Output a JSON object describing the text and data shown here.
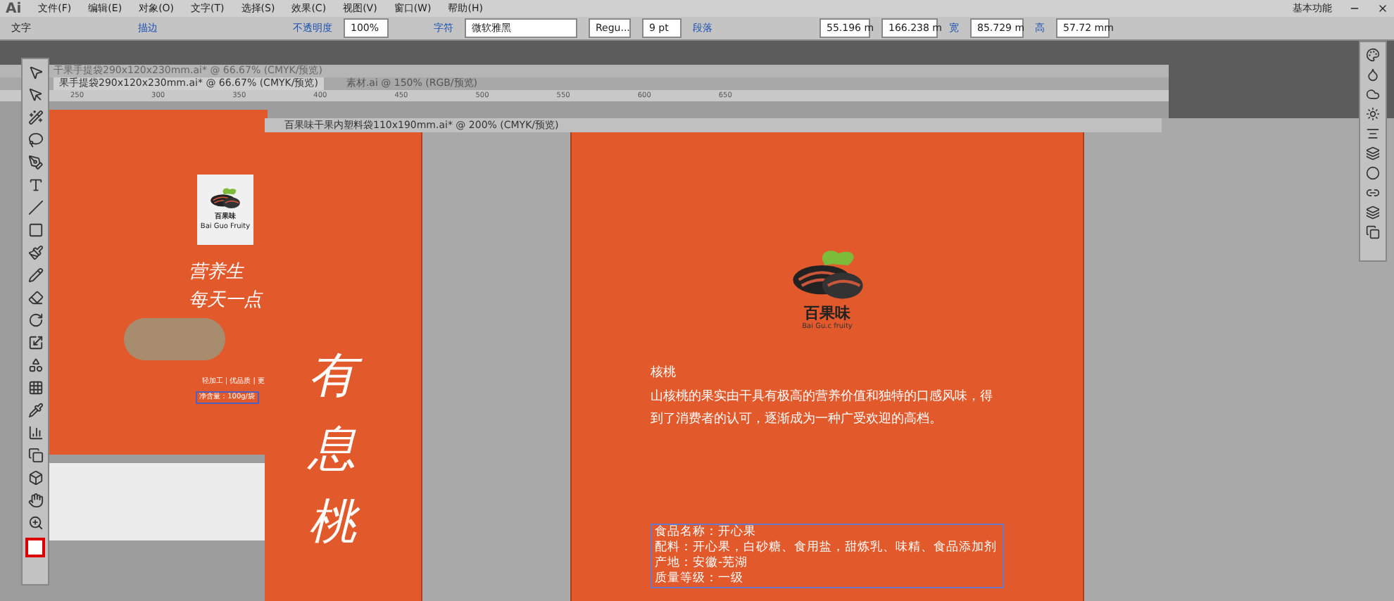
{
  "app": {
    "logo": "Ai",
    "menu": [
      "文件(F)",
      "编辑(E)",
      "对象(O)",
      "文字(T)",
      "选择(S)",
      "效果(C)",
      "视图(V)",
      "窗口(W)",
      "帮助(H)"
    ],
    "workspace": "基本功能"
  },
  "control_bar": {
    "tool": "文字",
    "stroke_label": "描边",
    "opacity_label": "不透明度",
    "opacity": "100%",
    "char_label": "字符",
    "font": "微软雅黑",
    "style": "Regu...",
    "size": "9 pt",
    "para_label": "段落",
    "x": "55.196 m",
    "y": "166.238 m",
    "w_label": "宽",
    "w": "85.729 m",
    "h_label": "高",
    "h": "57.72 mm"
  },
  "back_window": {
    "title": "干果手提袋290x120x230mm.ai* @ 66.67% (CMYK/预览)",
    "tabs": [
      {
        "label": "果手提袋290x120x230mm.ai* @ 66.67% (CMYK/预览)",
        "selected": true
      },
      {
        "label": "素材.ai @ 150% (RGB/预览)",
        "selected": false
      }
    ],
    "ruler": [
      "250",
      "300",
      "350",
      "400",
      "450",
      "500",
      "550",
      "600",
      "650"
    ],
    "brand": "百果味",
    "brand_latin": "Bai Guo Fruity",
    "slogan": [
      "营养生",
      "每天一点"
    ],
    "features": "轻加工 | 优品质 | 更",
    "net_weight": "净含量：100g/袋"
  },
  "front_window": {
    "title": "百果味干果内塑料袋110x190mm.ai* @ 200% (CMYK/预览)",
    "big_text": [
      "有",
      "息",
      "桃"
    ],
    "brand": "百果味",
    "brand_latin": "Bai Gu.c fruity",
    "heading": "核桃",
    "paragraph": "山核桃的果实由干具有极高的营养价值和独特的口感风味，得到了消费者的认可，逐渐成为一种广受欢迎的高档。",
    "info": [
      "食品名称：开心果",
      "配料：开心果，白砂糖、食用盐，甜炼乳、味精、食品添加剂",
      "产地：安徽-芜湖",
      "质量等级：一级"
    ]
  }
}
